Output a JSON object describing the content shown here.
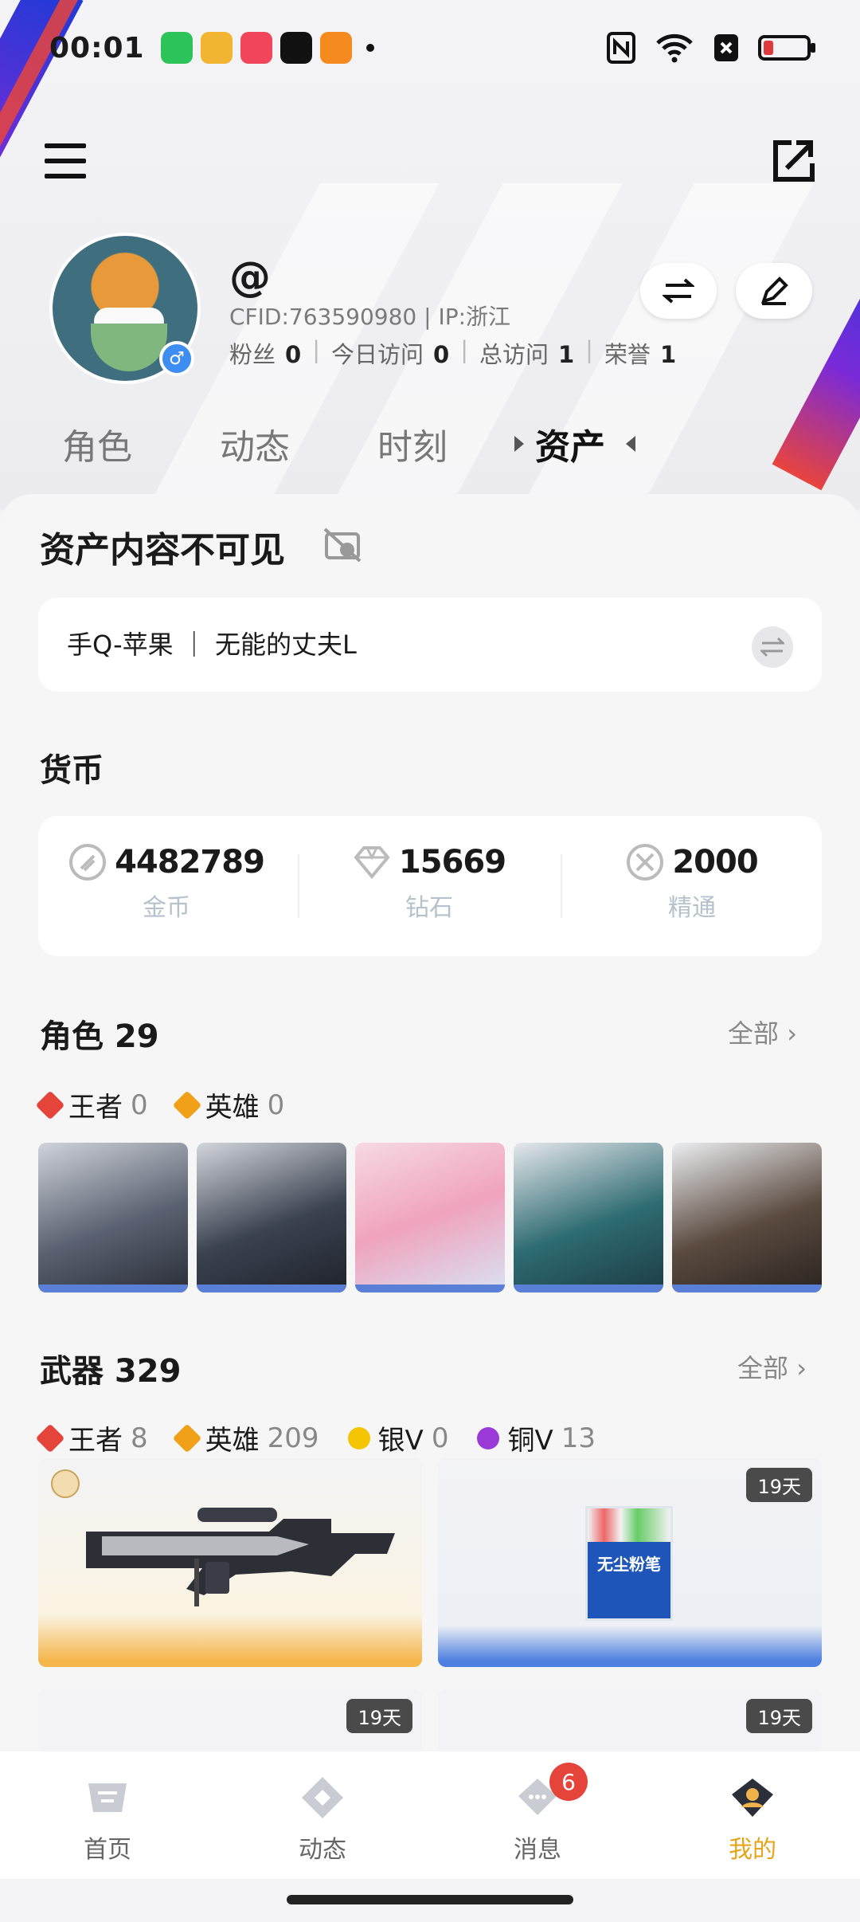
{
  "status": {
    "time": "00:01"
  },
  "profile": {
    "nickname": "@",
    "cfid": "CFID:763590980 | IP:浙江",
    "stats": [
      {
        "label": "粉丝",
        "value": "0"
      },
      {
        "label": "今日访问",
        "value": "0"
      },
      {
        "label": "总访问",
        "value": "1"
      },
      {
        "label": "荣誉",
        "value": "1"
      }
    ]
  },
  "tabs": [
    "角色",
    "动态",
    "时刻",
    "资产"
  ],
  "assets": {
    "hidden_title": "资产内容不可见",
    "account": "手Q-苹果 ｜ 无能的丈夫L"
  },
  "currency": {
    "title": "货币",
    "items": [
      {
        "value": "4482789",
        "label": "金币"
      },
      {
        "value": "15669",
        "label": "钻石"
      },
      {
        "value": "2000",
        "label": "精通"
      }
    ]
  },
  "roles": {
    "title": "角色 29",
    "more": "全部",
    "badges": [
      {
        "label": "王者",
        "count": "0",
        "color": "#e5443a"
      },
      {
        "label": "英雄",
        "count": "0",
        "color": "#f0a019"
      }
    ]
  },
  "weapons": {
    "title": "武器 329",
    "more": "全部",
    "badges": [
      {
        "label": "王者",
        "count": "8",
        "color": "#e5443a"
      },
      {
        "label": "英雄",
        "count": "209",
        "color": "#f0a019"
      },
      {
        "label": "银V",
        "count": "0",
        "color": "#f5c400"
      },
      {
        "label": "铜V",
        "count": "13",
        "color": "#9b38d8"
      }
    ],
    "days_badge": "19天",
    "chalk_text": "无尘粉笔"
  },
  "bottom_nav": [
    {
      "label": "首页"
    },
    {
      "label": "动态"
    },
    {
      "label": "消息",
      "badge": "6"
    },
    {
      "label": "我的"
    }
  ],
  "colors": {
    "accent": "#e5a51a",
    "notify": "#e5443a"
  }
}
